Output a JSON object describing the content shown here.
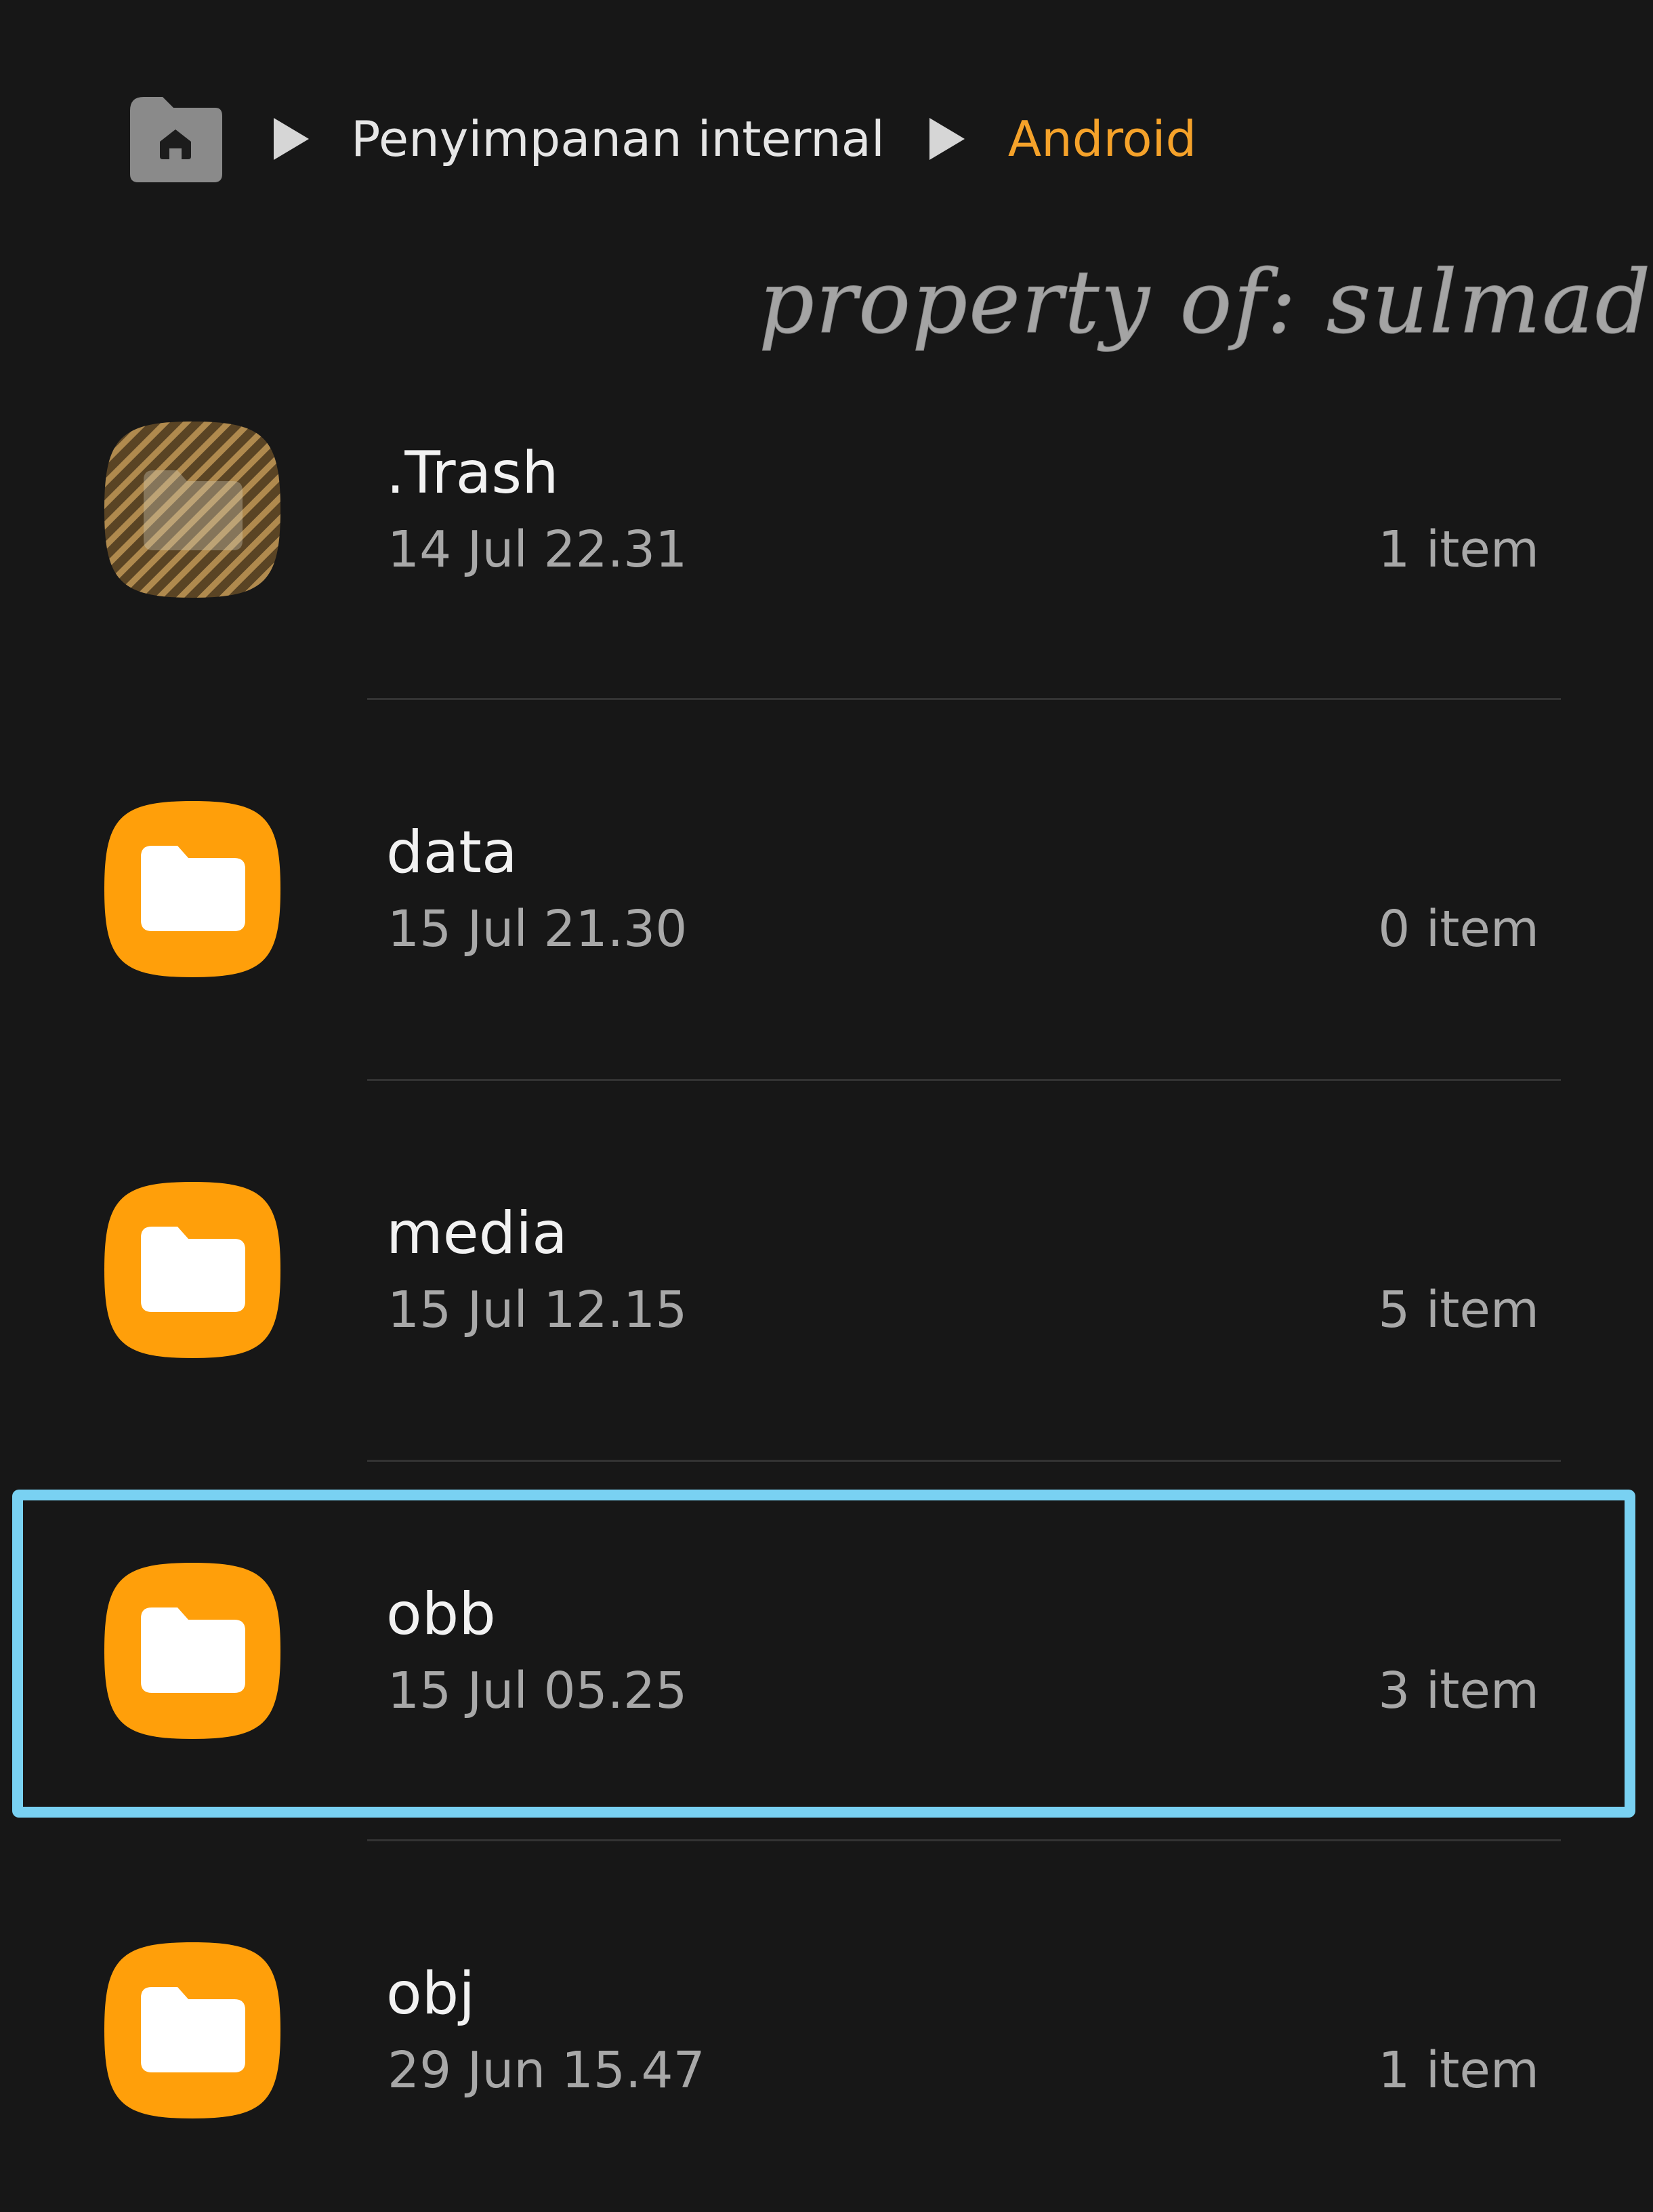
{
  "breadcrumb": {
    "home_icon": "home-folder-icon",
    "separator_icon": "play-arrow-icon",
    "items": [
      {
        "label": "Penyimpanan internal"
      },
      {
        "label": "Android",
        "current": true
      }
    ]
  },
  "watermark": "property of: sulmad",
  "files": [
    {
      "name": ".Trash",
      "date": "14 Jul 22.31",
      "count": "1 item",
      "icon": "trash-folder-icon"
    },
    {
      "name": "data",
      "date": "15 Jul 21.30",
      "count": "0 item",
      "icon": "folder-icon"
    },
    {
      "name": "media",
      "date": "15 Jul 12.15",
      "count": "5 item",
      "icon": "folder-icon"
    },
    {
      "name": "obb",
      "date": "15 Jul 05.25",
      "count": "3 item",
      "icon": "folder-icon",
      "highlighted": true
    },
    {
      "name": "obj",
      "date": "29 Jun 15.47",
      "count": "1 item",
      "icon": "folder-icon"
    }
  ],
  "colors": {
    "background": "#171717",
    "folder_orange": "#ff9f0a",
    "breadcrumb_active": "#f5a22a",
    "highlight_border": "#79d1f2"
  }
}
